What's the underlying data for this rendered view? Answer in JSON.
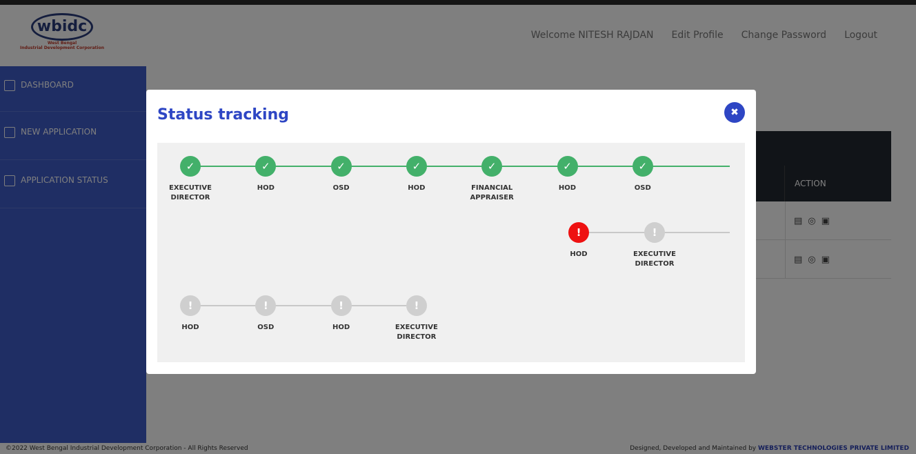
{
  "header": {
    "logo_text": "wbidc",
    "logo_subtitle_line1": "West Bengal",
    "logo_subtitle_line2": "Industrial Development Corporation",
    "welcome_text": "Welcome NITESH RAJDAN",
    "edit_profile": "Edit Profile",
    "change_password": "Change Password",
    "logout": "Logout"
  },
  "sidebar": {
    "items": [
      {
        "label": "DASHBOARD",
        "icon": "dashboard-icon"
      },
      {
        "label": "NEW APPLICATION",
        "icon": "application-icon"
      },
      {
        "label": "APPLICATION STATUS",
        "icon": "status-icon"
      }
    ]
  },
  "table": {
    "action_header": "ACTION",
    "rows": [
      {
        "actions": [
          "document-icon",
          "locate-icon",
          "payment-icon"
        ]
      },
      {
        "actions": [
          "document-icon",
          "locate-icon",
          "payment-icon"
        ]
      }
    ]
  },
  "footer": {
    "left": "©2022 West Bengal Industrial Development Corporation - All Rights Reserved",
    "right_prefix": "Designed, Developed and Maintained by ",
    "right_company": "WEBSTER TECHNOLOGIES PRIVATE LIMITED"
  },
  "modal": {
    "title": "Status tracking",
    "close_icon": "close-icon",
    "colors": {
      "done": "#43b06a",
      "current": "#ee1111",
      "pending": "#cfcfcf"
    },
    "rows": [
      {
        "steps": [
          {
            "line1": "EXECUTIVE",
            "line2": "DIRECTOR",
            "status": "done"
          },
          {
            "line1": "HOD",
            "line2": "",
            "status": "done"
          },
          {
            "line1": "OSD",
            "line2": "",
            "status": "done"
          },
          {
            "line1": "HOD",
            "line2": "",
            "status": "done"
          },
          {
            "line1": "FINANCIAL",
            "line2": "APPRAISER",
            "status": "done"
          },
          {
            "line1": "HOD",
            "line2": "",
            "status": "done"
          },
          {
            "line1": "OSD",
            "line2": "",
            "status": "done"
          }
        ]
      },
      {
        "steps": [
          {
            "line1": "HOD",
            "line2": "",
            "status": "current"
          },
          {
            "line1": "EXECUTIVE",
            "line2": "DIRECTOR",
            "status": "pending"
          }
        ]
      },
      {
        "steps": [
          {
            "line1": "HOD",
            "line2": "",
            "status": "pending"
          },
          {
            "line1": "OSD",
            "line2": "",
            "status": "pending"
          },
          {
            "line1": "HOD",
            "line2": "",
            "status": "pending"
          },
          {
            "line1": "EXECUTIVE",
            "line2": "DIRECTOR",
            "status": "pending"
          }
        ]
      }
    ]
  }
}
